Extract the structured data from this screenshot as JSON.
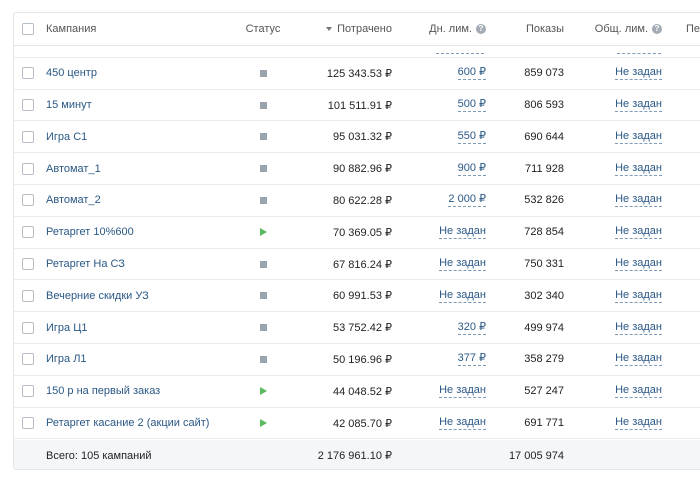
{
  "columns": {
    "campaign": "Кампания",
    "status": "Статус",
    "spent": "Потрачено",
    "daily_limit": "Дн. лим.",
    "views": "Показы",
    "total_limit": "Общ. лим.",
    "extra": "Пе"
  },
  "help_glyph": "?",
  "rows": [
    {
      "name": "450 центр",
      "status": "paused",
      "spent": "125 343.53 ₽",
      "daily": "600 ₽",
      "views": "859 073",
      "total": "Не задан"
    },
    {
      "name": "15 минут",
      "status": "paused",
      "spent": "101 511.91 ₽",
      "daily": "500 ₽",
      "views": "806 593",
      "total": "Не задан"
    },
    {
      "name": "Игра С1",
      "status": "paused",
      "spent": "95 031.32 ₽",
      "daily": "550 ₽",
      "views": "690 644",
      "total": "Не задан"
    },
    {
      "name": "Автомат_1",
      "status": "paused",
      "spent": "90 882.96 ₽",
      "daily": "900 ₽",
      "views": "711 928",
      "total": "Не задан"
    },
    {
      "name": "Автомат_2",
      "status": "paused",
      "spent": "80 622.28 ₽",
      "daily": "2 000 ₽",
      "views": "532 826",
      "total": "Не задан"
    },
    {
      "name": "Ретаргет 10%600",
      "status": "running",
      "spent": "70 369.05 ₽",
      "daily": "Не задан",
      "views": "728 854",
      "total": "Не задан"
    },
    {
      "name": "Ретаргет На СЗ",
      "status": "paused",
      "spent": "67 816.24 ₽",
      "daily": "Не задан",
      "views": "750 331",
      "total": "Не задан"
    },
    {
      "name": "Вечерние скидки УЗ",
      "status": "paused",
      "spent": "60 991.53 ₽",
      "daily": "Не задан",
      "views": "302 340",
      "total": "Не задан"
    },
    {
      "name": "Игра Ц1",
      "status": "paused",
      "spent": "53 752.42 ₽",
      "daily": "320 ₽",
      "views": "499 974",
      "total": "Не задан"
    },
    {
      "name": "Игра Л1",
      "status": "paused",
      "spent": "50 196.96 ₽",
      "daily": "377 ₽",
      "views": "358 279",
      "total": "Не задан"
    },
    {
      "name": "150 р на первый заказ",
      "status": "running",
      "spent": "44 048.52 ₽",
      "daily": "Не задан",
      "views": "527 247",
      "total": "Не задан"
    },
    {
      "name": "Ретаргет касание 2 (акции сайт)",
      "status": "running",
      "spent": "42 085.70 ₽",
      "daily": "Не задан",
      "views": "691 771",
      "total": "Не задан"
    }
  ],
  "footer": {
    "label": "Всего: 105 кампаний",
    "spent": "2 176 961.10 ₽",
    "views": "17 005 974"
  },
  "colors": {
    "link": "#2a5885",
    "status_paused": "#9aa2ab",
    "status_running": "#5cb85c"
  }
}
